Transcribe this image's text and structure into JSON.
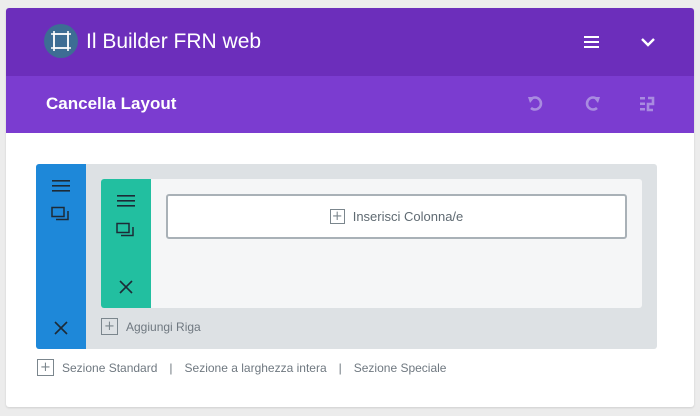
{
  "header": {
    "title": "Il Builder FRN web",
    "logo_icon": "builder-logo-icon",
    "menu_icon": "hamburger-icon",
    "collapse_icon": "chevron-down-icon",
    "bg_color": "#6c2ebb"
  },
  "toolbar": {
    "clear_layout_label": "Cancella Layout",
    "undo_icon": "undo-icon",
    "redo_icon": "redo-icon",
    "history_icon": "history-icon",
    "bg_color": "#7b3cd0"
  },
  "section": {
    "color": "#1e88d9",
    "icons": [
      "hamburger-icon",
      "duplicate-icon",
      "close-icon"
    ],
    "row": {
      "color": "#22bfa0",
      "icons": [
        "hamburger-icon",
        "duplicate-icon",
        "close-icon"
      ],
      "insert_columns_label": "Inserisci Colonna/e"
    },
    "add_row_label": "Aggiungi Riga"
  },
  "bottom": {
    "standard_section_label": "Sezione Standard",
    "fullwidth_section_label": "Sezione a larghezza intera",
    "special_section_label": "Sezione Speciale",
    "separator": "|"
  }
}
